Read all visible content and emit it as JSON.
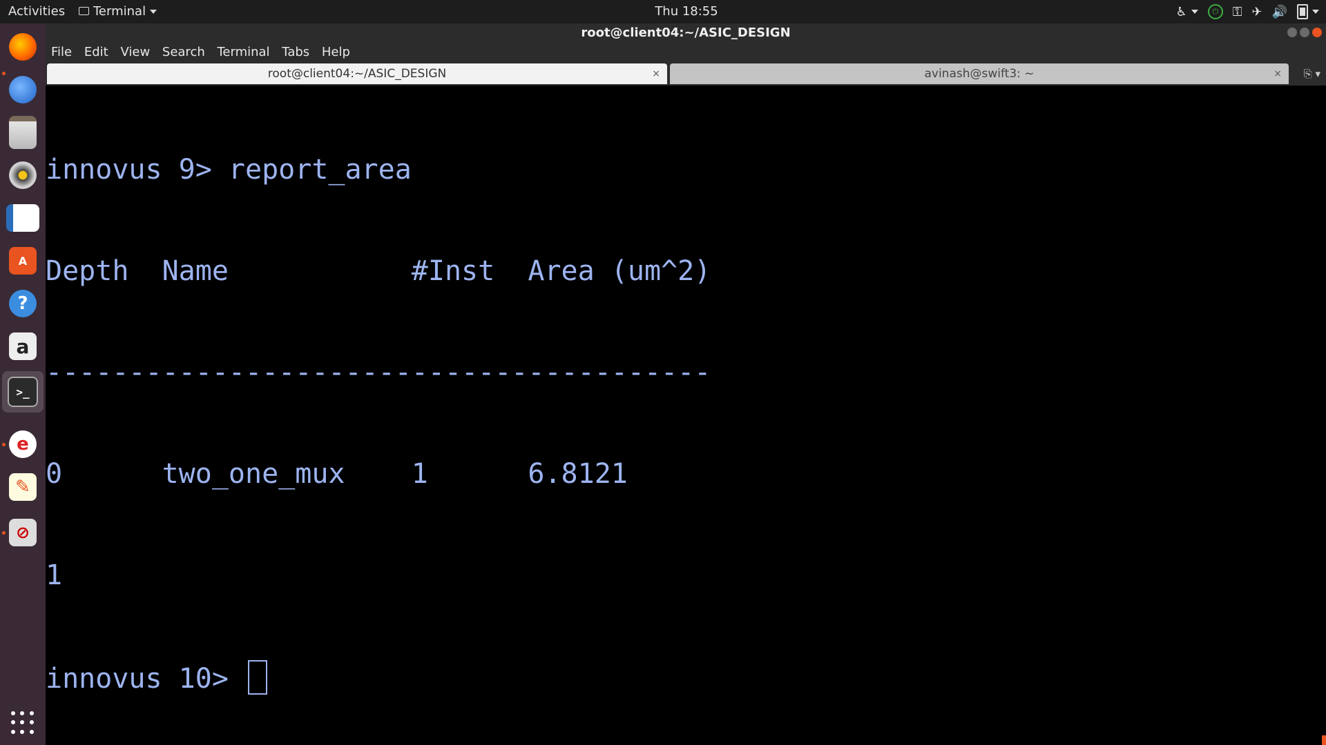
{
  "topbar": {
    "activities": "Activities",
    "app_name": "Terminal",
    "clock": "Thu 18:55"
  },
  "window": {
    "title": "root@client04:~/ASIC_DESIGN"
  },
  "menu": {
    "file": "File",
    "edit": "Edit",
    "view": "View",
    "search": "Search",
    "terminal": "Terminal",
    "tabs": "Tabs",
    "help": "Help"
  },
  "tabs": [
    {
      "label": "root@client04:~/ASIC_DESIGN",
      "close": "×"
    },
    {
      "label": "avinash@swift3: ~",
      "close": "×"
    }
  ],
  "terminal": {
    "lines": [
      "innovus 9> report_area",
      "Depth  Name           #Inst  Area (um^2)",
      "----------------------------------------",
      "0      two_one_mux    1      6.8121",
      "1"
    ],
    "prompt": "innovus 10> "
  },
  "colors": {
    "terminal_text": "#9db4f0",
    "accent": "#e95420",
    "dock_bg": "#3a2a35"
  },
  "dock_icons": [
    "firefox-icon",
    "thunderbird-icon",
    "files-icon",
    "rhythmbox-icon",
    "writer-icon",
    "software-center-icon",
    "help-icon",
    "amazon-icon",
    "terminal-icon",
    "app-icon",
    "text-editor-icon",
    "app-icon",
    "show-apps-icon"
  ]
}
